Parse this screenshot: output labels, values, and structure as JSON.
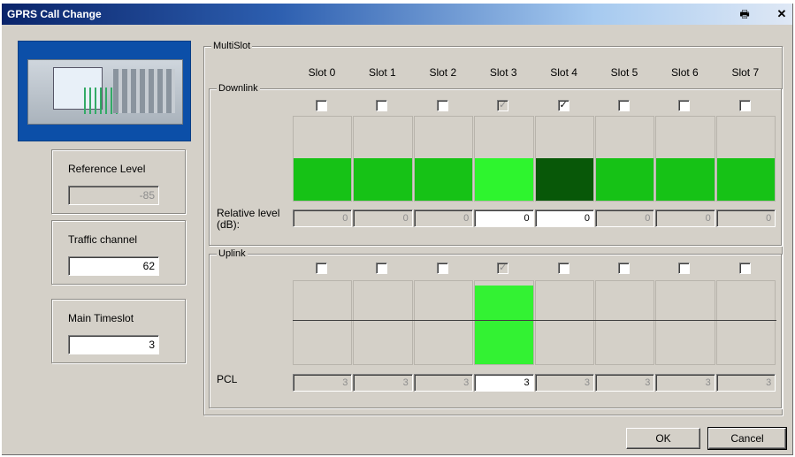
{
  "window": {
    "title": "GPRS Call Change"
  },
  "left": {
    "reference_level": {
      "label": "Reference Level",
      "value": "-85",
      "enabled": false
    },
    "traffic_channel": {
      "label": "Traffic channel",
      "value": "62",
      "enabled": true
    },
    "main_timeslot": {
      "label": "Main Timeslot",
      "value": "3",
      "enabled": true
    }
  },
  "multislot": {
    "label": "MultiSlot",
    "slots": [
      "Slot 0",
      "Slot 1",
      "Slot 2",
      "Slot 3",
      "Slot 4",
      "Slot 5",
      "Slot 6",
      "Slot 7"
    ],
    "downlink": {
      "label": "Downlink",
      "checked": [
        false,
        false,
        false,
        true,
        true,
        false,
        false,
        false
      ],
      "disabled": [
        false,
        false,
        false,
        true,
        false,
        false,
        false,
        false
      ],
      "bar_colors": [
        "#16c216",
        "#16c216",
        "#16c216",
        "#2ef52e",
        "#085808",
        "#16c216",
        "#16c216",
        "#16c216"
      ],
      "value_label": "Relative level\n(dB):",
      "values": [
        "0",
        "0",
        "0",
        "0",
        "0",
        "0",
        "0",
        "0"
      ],
      "value_enabled": [
        false,
        false,
        false,
        true,
        true,
        false,
        false,
        false
      ]
    },
    "uplink": {
      "label": "Uplink",
      "checked": [
        false,
        false,
        false,
        true,
        false,
        false,
        false,
        false
      ],
      "disabled": [
        false,
        false,
        false,
        true,
        false,
        false,
        false,
        false
      ],
      "active_slot": 3,
      "active_color": "#33f233",
      "value_label": "PCL",
      "values": [
        "3",
        "3",
        "3",
        "3",
        "3",
        "3",
        "3",
        "3"
      ],
      "value_enabled": [
        false,
        false,
        false,
        true,
        false,
        false,
        false,
        false
      ]
    }
  },
  "buttons": {
    "ok": "OK",
    "cancel": "Cancel"
  },
  "icons": {
    "print": "print-icon",
    "close": "close-icon"
  }
}
